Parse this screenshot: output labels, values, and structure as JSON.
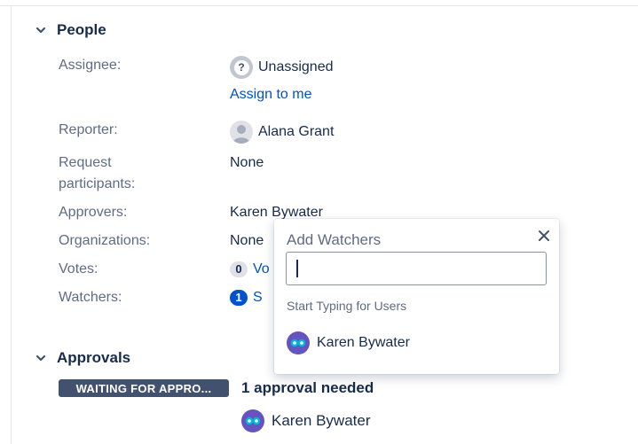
{
  "people": {
    "title": "People",
    "assignee": {
      "label": "Assignee:",
      "value": "Unassigned",
      "avatar_glyph": "?",
      "action": "Assign to me"
    },
    "reporter": {
      "label": "Reporter:",
      "value": "Alana Grant"
    },
    "participants": {
      "label_line1": "Request",
      "label_line2": "participants:",
      "value": "None"
    },
    "approvers": {
      "label": "Approvers:",
      "value": "Karen Bywater"
    },
    "organizations": {
      "label": "Organizations:",
      "value": "None"
    },
    "votes": {
      "label": "Votes:",
      "count": "0",
      "link_text": "Vo"
    },
    "watchers": {
      "label": "Watchers:",
      "count": "1",
      "link_text": "S"
    }
  },
  "approvals": {
    "title": "Approvals",
    "status": "WAITING FOR APPRO...",
    "needed": "1 approval needed",
    "approver": "Karen Bywater"
  },
  "add_watchers": {
    "title": "Add Watchers",
    "input_value": "",
    "hint": "Start Typing for Users",
    "suggestion": "Karen Bywater"
  },
  "colors": {
    "link": "#0052cc",
    "text": "#172b4d",
    "label": "#5e6c84",
    "lozenge": "#42526e",
    "avatar_purple": "#6554c0",
    "avatar_blue": "#00b8d9"
  },
  "icons": [
    "chevron-down-icon",
    "question-avatar-icon",
    "user-avatar-icon",
    "close-icon",
    "owl-avatar-icon"
  ]
}
